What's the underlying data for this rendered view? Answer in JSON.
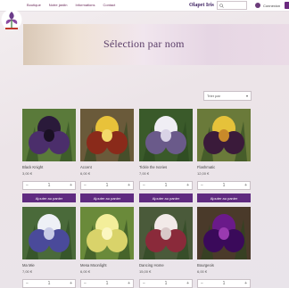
{
  "nav": {
    "items": [
      {
        "label": "Boutique"
      },
      {
        "label": "Notre jardin"
      },
      {
        "label": "Informations"
      },
      {
        "label": "Contact"
      }
    ]
  },
  "brand": {
    "name": "Olapet Iris"
  },
  "account": {
    "label": "Connexion"
  },
  "hero": {
    "title": "Sélection par nom"
  },
  "sort": {
    "label": "Trier par"
  },
  "products": [
    {
      "name": "Black Knight",
      "price": "3,00 €",
      "qty": "1",
      "button": "Ajouter au panier",
      "colors": [
        "#2a1a3a",
        "#4b2e6b",
        "#1a1024",
        "#5a7a3a"
      ]
    },
    {
      "name": "Accent",
      "price": "6,00 €",
      "qty": "1",
      "button": "Ajouter au panier",
      "colors": [
        "#e8c23a",
        "#8a2a1a",
        "#f3d96b",
        "#6a5a3a"
      ]
    },
    {
      "name": "Tickle the Ivories",
      "price": "7,00 €",
      "qty": "1",
      "button": "Ajouter au panier",
      "colors": [
        "#f0eef4",
        "#6a5a8a",
        "#d9d3e6",
        "#3a5a2a"
      ]
    },
    {
      "name": "Flashmatic",
      "price": "12,00 €",
      "qty": "1",
      "button": "Ajouter au panier",
      "colors": [
        "#e6c23a",
        "#3a1a3a",
        "#c98a2a",
        "#6a7a3a"
      ]
    },
    {
      "name": "Ma Mie",
      "price": "7,00 €",
      "qty": "1",
      "button": "Ajouter au panier",
      "colors": [
        "#eef0f6",
        "#4a4a9a",
        "#c8cbe6",
        "#4a6a3a"
      ]
    },
    {
      "name": "Mesa Moonlight",
      "price": "6,00 €",
      "qty": "1",
      "button": "Ajouter au panier",
      "colors": [
        "#f3ee9a",
        "#d9d36a",
        "#fbf6c0",
        "#6a8a3a"
      ]
    },
    {
      "name": "Dancing Home",
      "price": "15,00 €",
      "qty": "1",
      "button": "Ajouter au panier",
      "colors": [
        "#f2eae8",
        "#8a2a3a",
        "#d9c8c8",
        "#4a5a3a"
      ]
    },
    {
      "name": "Bourgeois",
      "price": "6,00 €",
      "qty": "1",
      "button": "Ajouter au panier",
      "colors": [
        "#6a1a8a",
        "#3a0a5a",
        "#9a3ab0",
        "#4a3a2a"
      ]
    }
  ]
}
